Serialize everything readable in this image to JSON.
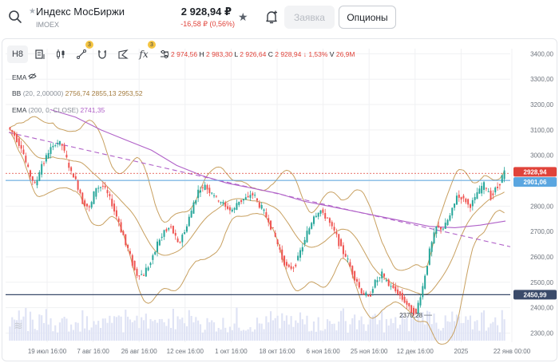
{
  "header": {
    "instrument_name": "Индекс МосБиржи",
    "ticker": "IMOEX",
    "price": "2 928,94 ₽",
    "change": "-16,58 ₽ (0,56%)",
    "order_button": "Заявка",
    "options_button": "Опционы"
  },
  "toolbar": {
    "timeframe": "H8",
    "drawing_badge": "3",
    "indicators_badge": "3"
  },
  "ohlc": {
    "o_label": "O",
    "o": "2 974,56",
    "h_label": "H",
    "h": "2 983,30",
    "l_label": "L",
    "l": "2 926,64",
    "c_label": "C",
    "c": "2 928,94",
    "chg": "↓ 1,53%",
    "v_label": "V",
    "v": "26,9M"
  },
  "legend": {
    "ema_short": "EMA",
    "bb_name": "BB",
    "bb_params": "(20, 2,00000)",
    "bb_values": "2756,74 2855,13 2953,52",
    "ema_name": "EMA",
    "ema_params": "(200, 0, CLOSE)",
    "ema_value": "2741,35"
  },
  "colors": {
    "up": "#26a69a",
    "down": "#ef5350",
    "bollinger": "#c8a060",
    "ema": "#b061c8",
    "blue_line": "#5aa6e0",
    "navy_line": "#3a4a6a",
    "price_tag": "#e0433a"
  },
  "chart_data": {
    "type": "candlestick",
    "y_ticks": [
      "3400,00",
      "3300,00",
      "3200,00",
      "3100,00",
      "3000,00",
      "2900,00",
      "2800,00",
      "2700,00",
      "2600,00",
      "2500,00",
      "2400,00",
      "2300,00"
    ],
    "ylim": [
      2270,
      3420
    ],
    "x_ticks": [
      "19 июл 16:00",
      "7 авг 16:00",
      "26 авг 16:00",
      "12 сен 16:00",
      "1 окт 16:00",
      "18 окт 16:00",
      "6 ноя 16:00",
      "25 ноя 16:00",
      "12 дек 16:00",
      "2025",
      "22 янв 00:00"
    ],
    "last_price_label": "2928,94",
    "blue_level_label": "2901,06",
    "navy_level_label": "2450,99",
    "low_annotation": "2370,28",
    "blue_level": 2901,
    "navy_level": 2451,
    "low_value": 2370.28,
    "last_price": 2928.94,
    "price_path": [
      3110,
      3080,
      3030,
      2940,
      2880,
      2960,
      3010,
      3050,
      3040,
      2950,
      2900,
      2820,
      2790,
      2870,
      2880,
      2830,
      2760,
      2680,
      2600,
      2530,
      2530,
      2580,
      2650,
      2700,
      2720,
      2650,
      2700,
      2780,
      2860,
      2880,
      2850,
      2820,
      2800,
      2780,
      2820,
      2830,
      2850,
      2800,
      2760,
      2700,
      2620,
      2560,
      2560,
      2620,
      2690,
      2760,
      2780,
      2750,
      2700,
      2640,
      2580,
      2520,
      2460,
      2440,
      2500,
      2530,
      2490,
      2470,
      2440,
      2400,
      2380,
      2480,
      2620,
      2720,
      2710,
      2760,
      2840,
      2830,
      2800,
      2850,
      2880,
      2840,
      2880,
      2930
    ]
  }
}
